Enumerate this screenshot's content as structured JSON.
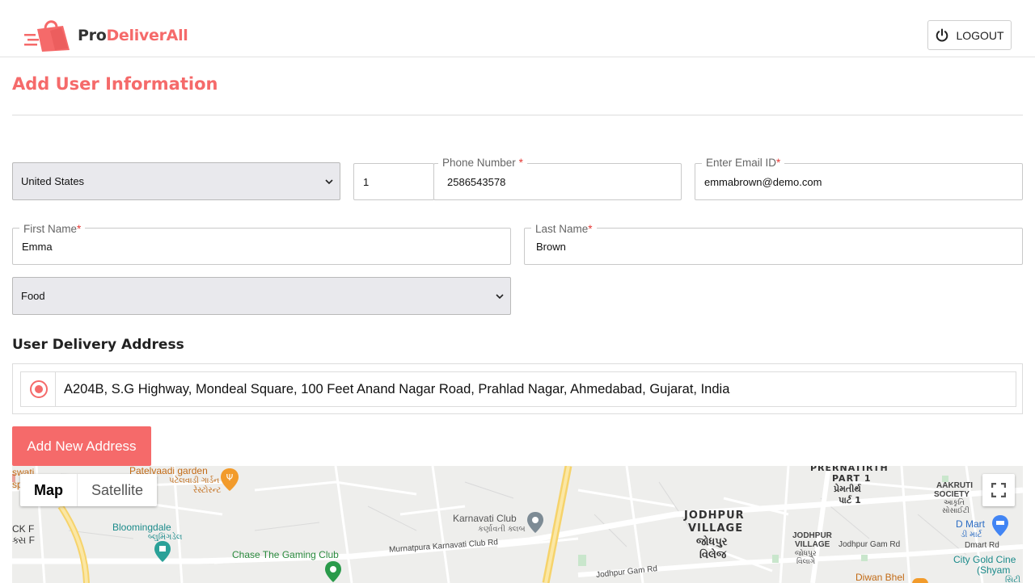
{
  "brand": {
    "pro": "Pro",
    "rest": "DeliverAll",
    "accent": "#f56a6a"
  },
  "header": {
    "logout_label": "LOGOUT",
    "logout_icon": "power-icon"
  },
  "page": {
    "title": "Add User Information"
  },
  "form": {
    "country": {
      "value": "United States"
    },
    "phone_code": {
      "value": "1"
    },
    "phone": {
      "label": "Phone Number",
      "required": "*",
      "value": "2586543578"
    },
    "email": {
      "label": "Enter Email ID",
      "required": "*",
      "value": "emmabrown@demo.com"
    },
    "first_name": {
      "label": "First Name",
      "required": "*",
      "value": "Emma"
    },
    "last_name": {
      "label": "Last Name",
      "required": "*",
      "value": "Brown"
    },
    "service": {
      "value": "Food"
    }
  },
  "address_section": {
    "title": "User Delivery Address",
    "addresses": [
      {
        "text": "A204B, S.G Highway, Mondeal Square, 100 Feet Anand Nagar Road, Prahlad Nagar, Ahmedabad, Gujarat, India",
        "selected": true
      }
    ],
    "add_button": "Add New Address"
  },
  "map": {
    "map_type": {
      "map": "Map",
      "satellite": "Satellite",
      "active": "Map"
    },
    "labels": {
      "swati": "swati",
      "sp": "sp",
      "ck": "CK F",
      "ck2": "ક્સ F",
      "patelvaadi": "Patelvaadi garden",
      "patelvaadi_gu": "પટેલવાડી ગાર્ડન",
      "patelvaadi_gu2": "રેસ્ટોરન્ટ",
      "bloomingdale": "Bloomingdale",
      "bloomingdale_gu": "બ્લુમિંગડેલ",
      "chase": "Chase The Gaming Club",
      "karnavati": "Karnavati Club",
      "karnavati_gu": "કર્ણાવતી ક્લબ",
      "murnatpura": "Murnatpura Karnavati Club Rd",
      "jodhpur_rd1": "Jodhpur Gam Rd",
      "jodhpur_village1": "JODHPUR",
      "jodhpur_village2": "VILLAGE",
      "jodhpur_village_gu1": "જોધપુર",
      "jodhpur_village_gu2": "વિલેજ",
      "jv_small1": "JODHPUR",
      "jv_small2": "VILLAGE",
      "jv_small_gu1": "જોધપુર",
      "jv_small_gu2": "વિલાગે",
      "jodhpur_rd2": "Jodhpur Gam Rd",
      "prernatirth1": "PRERNATIRTH",
      "prernatirth2": "PART 1",
      "prernatirth_gu1": "પ્રેમતીર્થ",
      "prernatirth_gu2": "પાર્ટ 1",
      "aakruti1": "AAKRUTI",
      "aakruti2": "SOCIETY",
      "aakruti_gu1": "આકૃતિ",
      "aakruti_gu2": "સોસાઈટી",
      "dmart": "D Mart",
      "dmart_gu": "ડી માર્ટ",
      "dmart_rd": "Dmart Rd",
      "citygold": "City Gold Cine",
      "shyam": "(Shyam",
      "shyam_gu": "સિટી",
      "diwan": "Diwan Bhel"
    }
  }
}
